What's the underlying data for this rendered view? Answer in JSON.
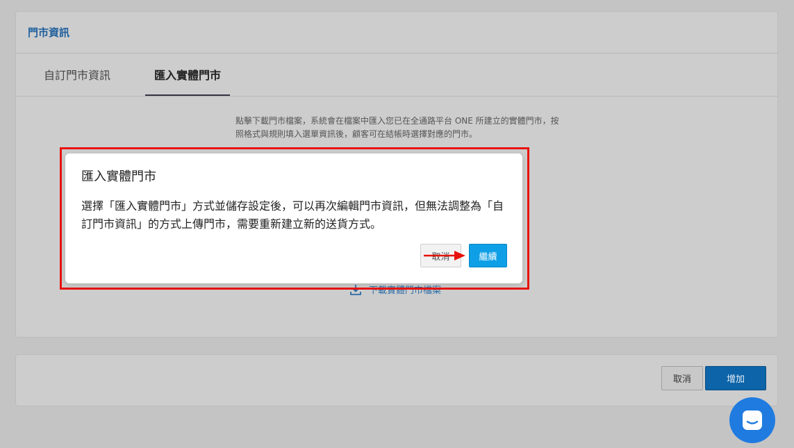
{
  "store_card": {
    "title": "門市資訊",
    "tabs": [
      {
        "label": "自訂門市資訊"
      },
      {
        "label": "匯入實體門市"
      }
    ],
    "description": "點擊下載門市檔案，系統會在檔案中匯入您已在全通路平台 ONE 所建立的實體門市，按照格式與規則填入選單資訊後，顧客可在結帳時選擇對應的門市。",
    "download_label": "下載實體門市檔案"
  },
  "footer": {
    "cancel_label": "取消",
    "add_label": "增加"
  },
  "modal": {
    "title": "匯入實體門市",
    "body": "選擇「匯入實體門市」方式並儲存設定後，可以再次編輯門市資訊，但無法調整為「自訂門市資訊」的方式上傳門市，需要重新建立新的送貨方式。",
    "cancel_label": "取消",
    "continue_label": "繼續"
  },
  "colors": {
    "highlight": "#e8120c",
    "primary": "#0e9fe6",
    "chat": "#1f7be0"
  },
  "icons": [
    "download-icon",
    "chat-icon",
    "arrow-right-icon"
  ]
}
